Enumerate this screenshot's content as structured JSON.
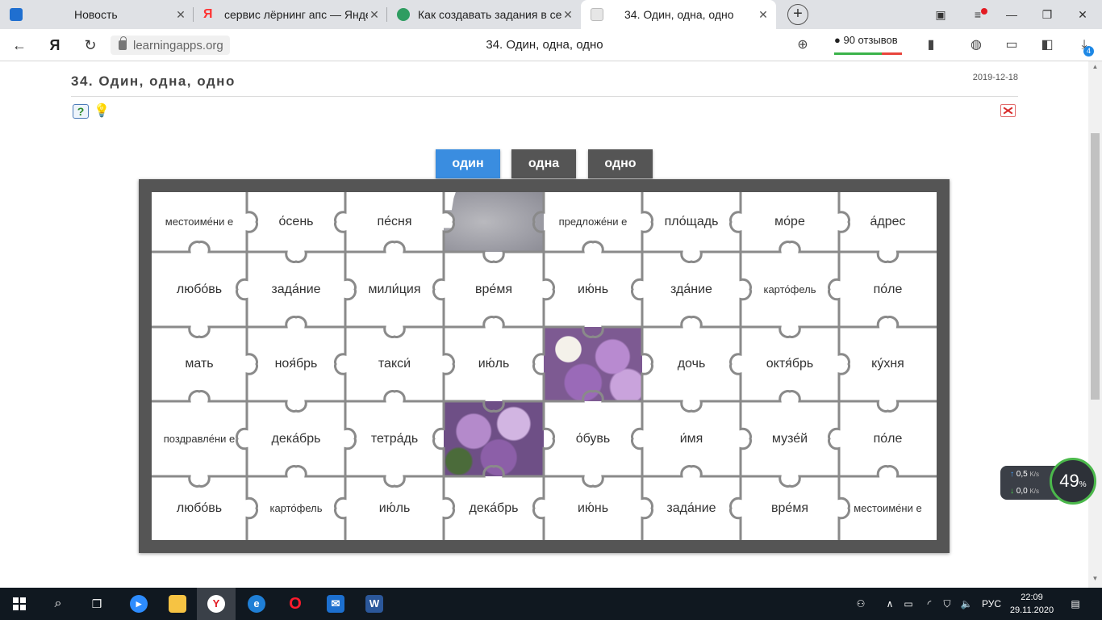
{
  "browser": {
    "tabs": [
      {
        "title": "Новость",
        "color": "#1f6fd0"
      },
      {
        "title": "сервис лёрнинг апс — Янде",
        "color": "#ff3333"
      },
      {
        "title": "Как создавать задания в сер",
        "color": "#2f9d61"
      },
      {
        "title": "34. Один, одна, одно",
        "color": "#c8c8c8"
      }
    ],
    "new_tab": "+",
    "window": {
      "minimize": "—",
      "maximize": "❐",
      "close": "✕"
    },
    "address": {
      "domain": "learningapps.org",
      "page_title": "34. Один, одна, одно",
      "reviews": "90 отзывов",
      "downloads_badge": "4"
    }
  },
  "app": {
    "title": "34. Один, одна, одно",
    "date": "2019-12-18"
  },
  "categories": [
    {
      "label": "один",
      "color": "#3a8de0"
    },
    {
      "label": "одна",
      "color": "#555555"
    },
    {
      "label": "одно",
      "color": "#555555"
    }
  ],
  "puzzle": {
    "rows": [
      [
        "местоиме́ни е",
        "о́сень",
        "пе́сня",
        "",
        "предложе́ни е",
        "пло́щадь",
        "мо́ре",
        "а́дрес"
      ],
      [
        "любо́вь",
        "зада́ние",
        "мили́ция",
        "вре́мя",
        "ию́нь",
        "зда́ние",
        "карто́фель",
        "по́ле"
      ],
      [
        "мать",
        "ноя́брь",
        "такси́",
        "ию́ль",
        "",
        "дочь",
        "октя́брь",
        "ку́хня"
      ],
      [
        "поздравле́ни е",
        "дека́брь",
        "тетра́дь",
        "",
        "о́бувь",
        "и́мя",
        "музе́й",
        "по́ле"
      ],
      [
        "любо́вь",
        "карто́фель",
        "ию́ль",
        "дека́брь",
        "ию́нь",
        "зада́ние",
        "вре́мя",
        "местоиме́ни е"
      ]
    ]
  },
  "widget": {
    "up": "0,5",
    "down": "0,0",
    "unit": "K/s",
    "percent": "49",
    "percent_sign": "%"
  },
  "taskbar": {
    "lang": "РУС",
    "time": "22:09",
    "date": "29.11.2020"
  }
}
